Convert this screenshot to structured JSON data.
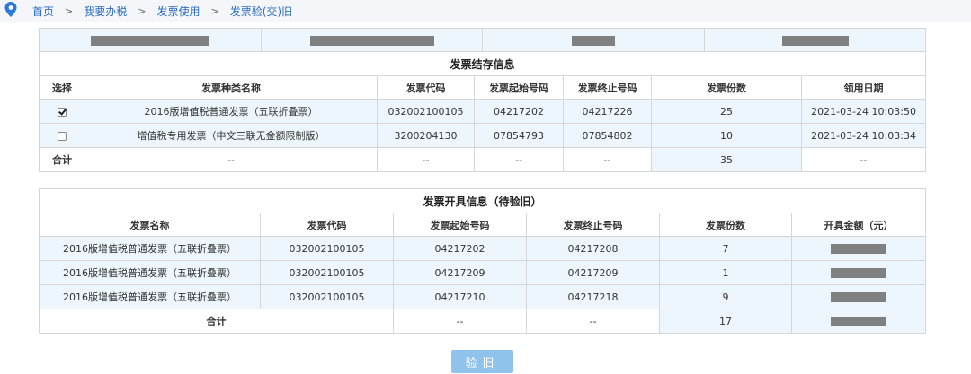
{
  "breadcrumb": [
    "首页",
    "我要办税",
    "发票使用",
    "发票验(交)旧"
  ],
  "stock": {
    "title": "发票结存信息",
    "headers": [
      "选择",
      "发票种类名称",
      "发票代码",
      "发票起始号码",
      "发票终止号码",
      "发票份数",
      "领用日期"
    ],
    "rows": [
      {
        "checked": true,
        "name": "2016版增值税普通发票（五联折叠票）",
        "code": "032002100105",
        "start": "04217202",
        "end": "04217226",
        "count": "25",
        "date": "2021-03-24 10:03:50"
      },
      {
        "checked": false,
        "name": "增值税专用发票（中文三联无金额限制版）",
        "code": "3200204130",
        "start": "07854793",
        "end": "07854802",
        "count": "10",
        "date": "2021-03-24 10:03:34"
      }
    ],
    "total": {
      "label": "合计",
      "name": "--",
      "code": "--",
      "start": "--",
      "end": "--",
      "count": "35",
      "date": "--"
    }
  },
  "issued": {
    "title": "发票开具信息（待验旧）",
    "headers": [
      "发票名称",
      "发票代码",
      "发票起始号码",
      "发票终止号码",
      "发票份数",
      "开具金额（元）"
    ],
    "rows": [
      {
        "name": "2016版增值税普通发票（五联折叠票）",
        "code": "032002100105",
        "start": "04217202",
        "end": "04217208",
        "count": "7"
      },
      {
        "name": "2016版增值税普通发票（五联折叠票）",
        "code": "032002100105",
        "start": "04217209",
        "end": "04217209",
        "count": "1"
      },
      {
        "name": "2016版增值税普通发票（五联折叠票）",
        "code": "032002100105",
        "start": "04217210",
        "end": "04217218",
        "count": "9"
      }
    ],
    "total": {
      "label": "合计",
      "start": "--",
      "end": "--",
      "count": "17"
    }
  },
  "button_label": "验旧"
}
